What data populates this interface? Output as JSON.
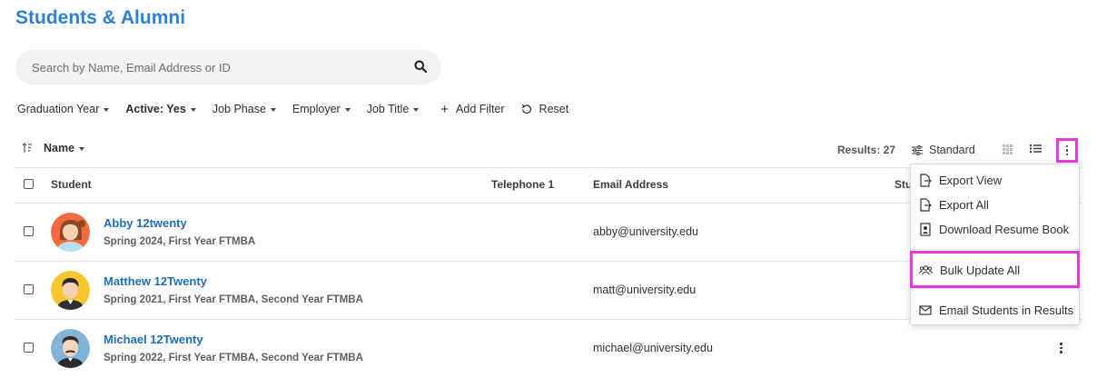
{
  "page": {
    "title": "Students & Alumni"
  },
  "search": {
    "placeholder": "Search by Name, Email Address or ID"
  },
  "filters": [
    {
      "label": "Graduation Year",
      "bold": false
    },
    {
      "label": "Active: Yes",
      "bold": true
    },
    {
      "label": "Job Phase",
      "bold": false
    },
    {
      "label": "Employer",
      "bold": false
    },
    {
      "label": "Job Title",
      "bold": false
    }
  ],
  "add_filter_label": "Add Filter",
  "reset_label": "Reset",
  "sort": {
    "label": "Name"
  },
  "results_label": "Results: 27",
  "view": {
    "standard_label": "Standard"
  },
  "columns": {
    "student": "Student",
    "telephone": "Telephone 1",
    "email": "Email Address",
    "status_partial": "Stu"
  },
  "students": [
    {
      "name": "Abby 12twenty",
      "subtitle": "Spring 2024, First Year FTMBA",
      "email": "abby@university.edu",
      "avatar_color": "#f26a3d"
    },
    {
      "name": "Matthew 12Twenty",
      "subtitle": "Spring 2021, First Year FTMBA, Second Year FTMBA",
      "email": "matt@university.edu",
      "avatar_color": "#f7c530"
    },
    {
      "name": "Michael 12Twenty",
      "subtitle": "Spring 2022, First Year FTMBA, Second Year FTMBA",
      "email": "michael@university.edu",
      "avatar_color": "#82b4d9"
    }
  ],
  "menu": {
    "export_view": "Export View",
    "export_all": "Export All",
    "download_resume_book": "Download Resume Book",
    "bulk_update_all": "Bulk Update All",
    "email_students": "Email Students in Results"
  },
  "colors": {
    "title": "#2f7fd1",
    "link": "#1f6db3",
    "highlight": "#e53bdc"
  }
}
